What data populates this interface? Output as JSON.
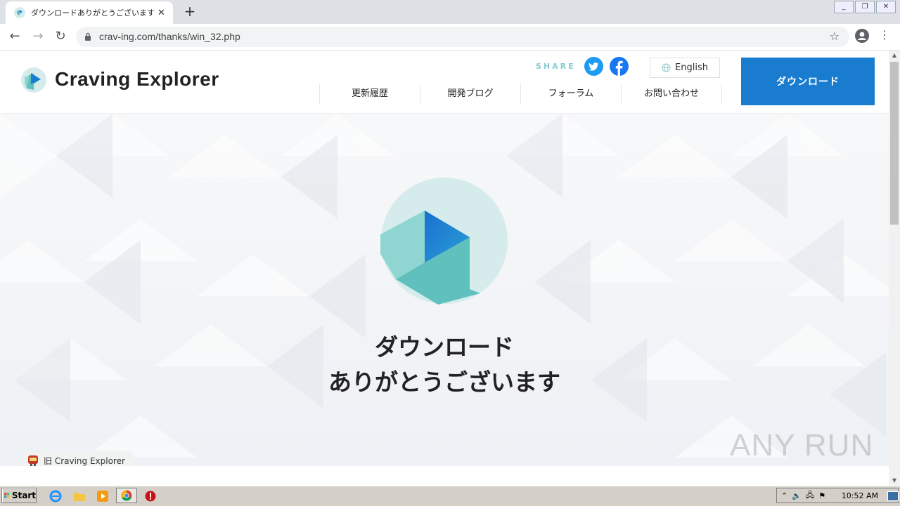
{
  "browser": {
    "tab_title": "ダウンロードありがとうございます ｜ Craving Explorer",
    "url": "crav-ing.com/thanks/win_32.php",
    "window_controls": [
      "minimize",
      "restore",
      "close"
    ]
  },
  "header": {
    "logo_text": "Craving Explorer",
    "share_label": "SHARE",
    "language_label": "English",
    "nav": [
      {
        "label": "更新履歴"
      },
      {
        "label": "開発ブログ"
      },
      {
        "label": "フォーラム"
      },
      {
        "label": "お問い合わせ"
      }
    ],
    "download_label": "ダウンロード"
  },
  "hero": {
    "title_line1": "ダウンロード",
    "title_line2": "ありがとうございます",
    "old_version_label": "旧 Craving Explorer",
    "watermark": "ANY RUN"
  },
  "taskbar": {
    "start_label": "Start",
    "clock": "10:52 AM"
  },
  "colors": {
    "brand_blue": "#1a7ccf",
    "teal": "#5fc0bd",
    "light_teal": "#d6ecec",
    "twitter": "#1d9bf0",
    "facebook": "#1877f2"
  }
}
